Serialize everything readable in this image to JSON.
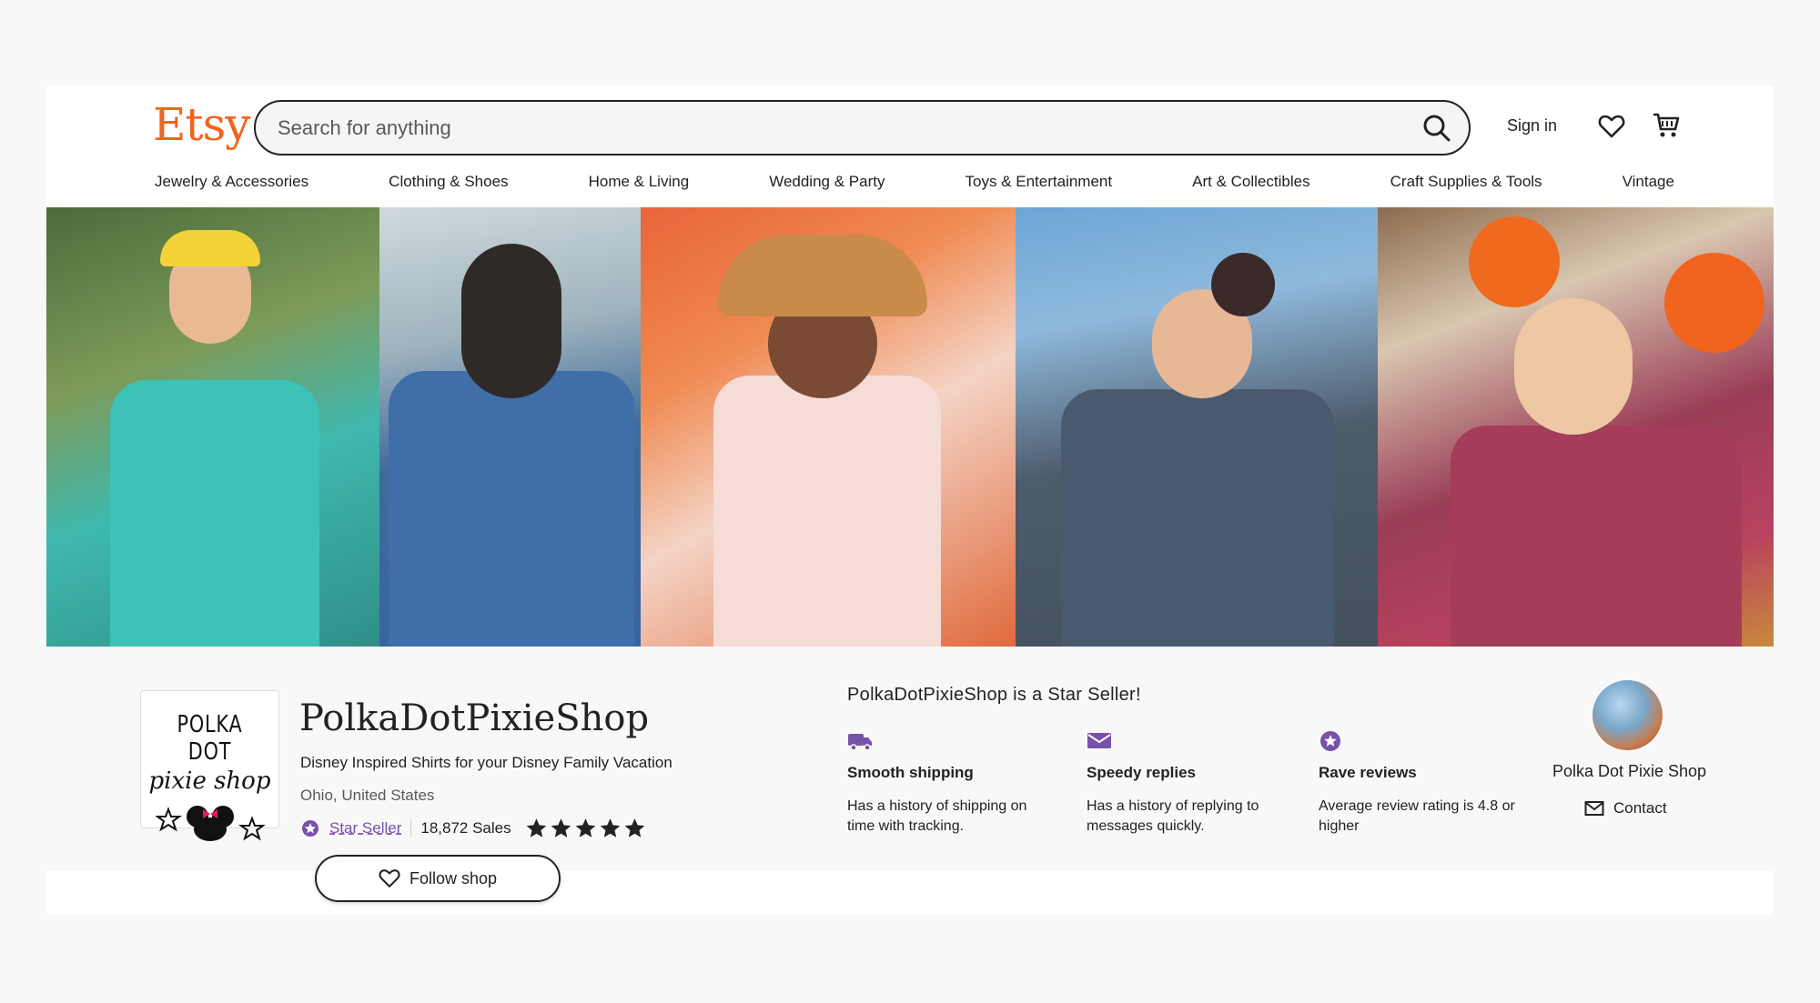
{
  "header": {
    "logo": "Etsy",
    "search_placeholder": "Search for anything",
    "signin": "Sign in",
    "icons": {
      "search": "search-icon",
      "favorites": "heart-icon",
      "cart": "cart-icon"
    }
  },
  "nav": {
    "items": [
      {
        "label": "Jewelry & Accessories"
      },
      {
        "label": "Clothing & Shoes"
      },
      {
        "label": "Home & Living"
      },
      {
        "label": "Wedding & Party"
      },
      {
        "label": "Toys & Entertainment"
      },
      {
        "label": "Art & Collectibles"
      },
      {
        "label": "Craft Supplies & Tools"
      },
      {
        "label": "Vintage"
      }
    ]
  },
  "banner": {
    "photos": [
      "banner-photo-tiki-shirt",
      "banner-photo-eat-shirt",
      "banner-photo-pumpkin-shirt",
      "banner-photo-be-kind-shirt",
      "banner-photo-wonderful-shirt"
    ]
  },
  "shop": {
    "logo_line1": "POLKA DOT",
    "logo_line2": "pixie shop",
    "name": "PolkaDotPixieShop",
    "tagline": "Disney Inspired Shirts for your Disney Family Vacation",
    "location": "Ohio, United States",
    "star_seller_label": "Star Seller",
    "sales": "18,872 Sales",
    "rating_stars": 5,
    "follow_label": "Follow shop"
  },
  "star_seller": {
    "title": "PolkaDotPixieShop is a Star Seller!",
    "features": [
      {
        "icon": "truck-icon",
        "title": "Smooth shipping",
        "desc": "Has a history of shipping on time with tracking."
      },
      {
        "icon": "message-icon",
        "title": "Speedy replies",
        "desc": "Has a history of replying to messages quickly."
      },
      {
        "icon": "star-badge-icon",
        "title": "Rave reviews",
        "desc": "Average review rating is 4.8 or higher"
      }
    ]
  },
  "owner": {
    "name": "Polka Dot Pixie Shop",
    "contact_label": "Contact"
  },
  "colors": {
    "brand": "#f1641e",
    "star_seller": "#7851a9",
    "text": "#222222"
  }
}
